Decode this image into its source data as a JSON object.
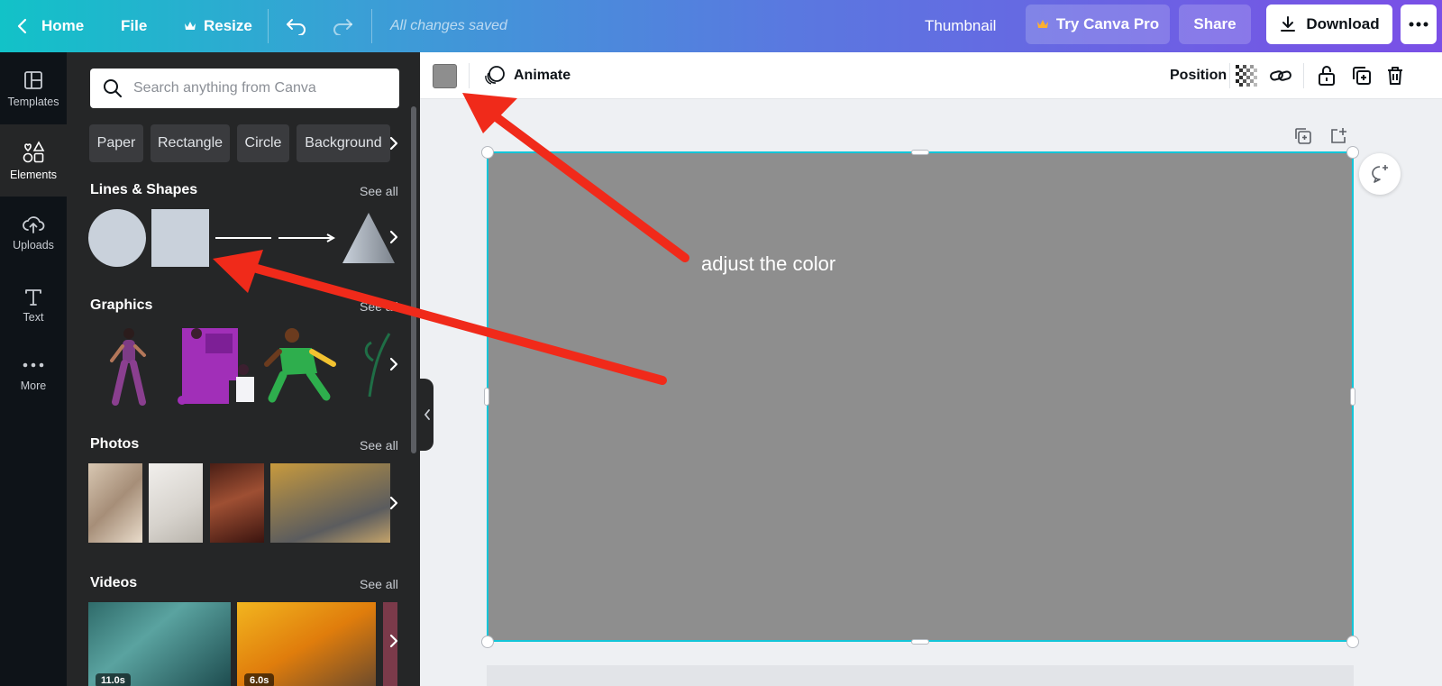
{
  "topbar": {
    "home": "Home",
    "file": "File",
    "resize": "Resize",
    "saved": "All changes saved",
    "title": "Thumbnail",
    "try_pro": "Try Canva Pro",
    "share": "Share",
    "download": "Download"
  },
  "rail": {
    "items": [
      {
        "label": "Templates",
        "icon": "templates-icon"
      },
      {
        "label": "Elements",
        "icon": "elements-icon"
      },
      {
        "label": "Uploads",
        "icon": "upload-cloud-icon"
      },
      {
        "label": "Text",
        "icon": "text-icon"
      },
      {
        "label": "More",
        "icon": "more-dots-icon"
      }
    ]
  },
  "panel": {
    "search_placeholder": "Search anything from Canva",
    "chips": [
      "Paper",
      "Rectangle",
      "Circle",
      "Background"
    ],
    "sections": {
      "lines_shapes": "Lines & Shapes",
      "graphics": "Graphics",
      "photos": "Photos",
      "videos": "Videos",
      "see_all": "See all"
    },
    "videos": [
      {
        "duration": "11.0s"
      },
      {
        "duration": "6.0s"
      }
    ]
  },
  "toolbar": {
    "fill_color": "#8e8e8e",
    "animate": "Animate",
    "position": "Position"
  },
  "canvas": {
    "element_color": "#8e8e8e",
    "selection_color": "#13c5d8"
  },
  "annotation": {
    "text": "adjust the color",
    "arrow_color": "#f02a1a"
  }
}
